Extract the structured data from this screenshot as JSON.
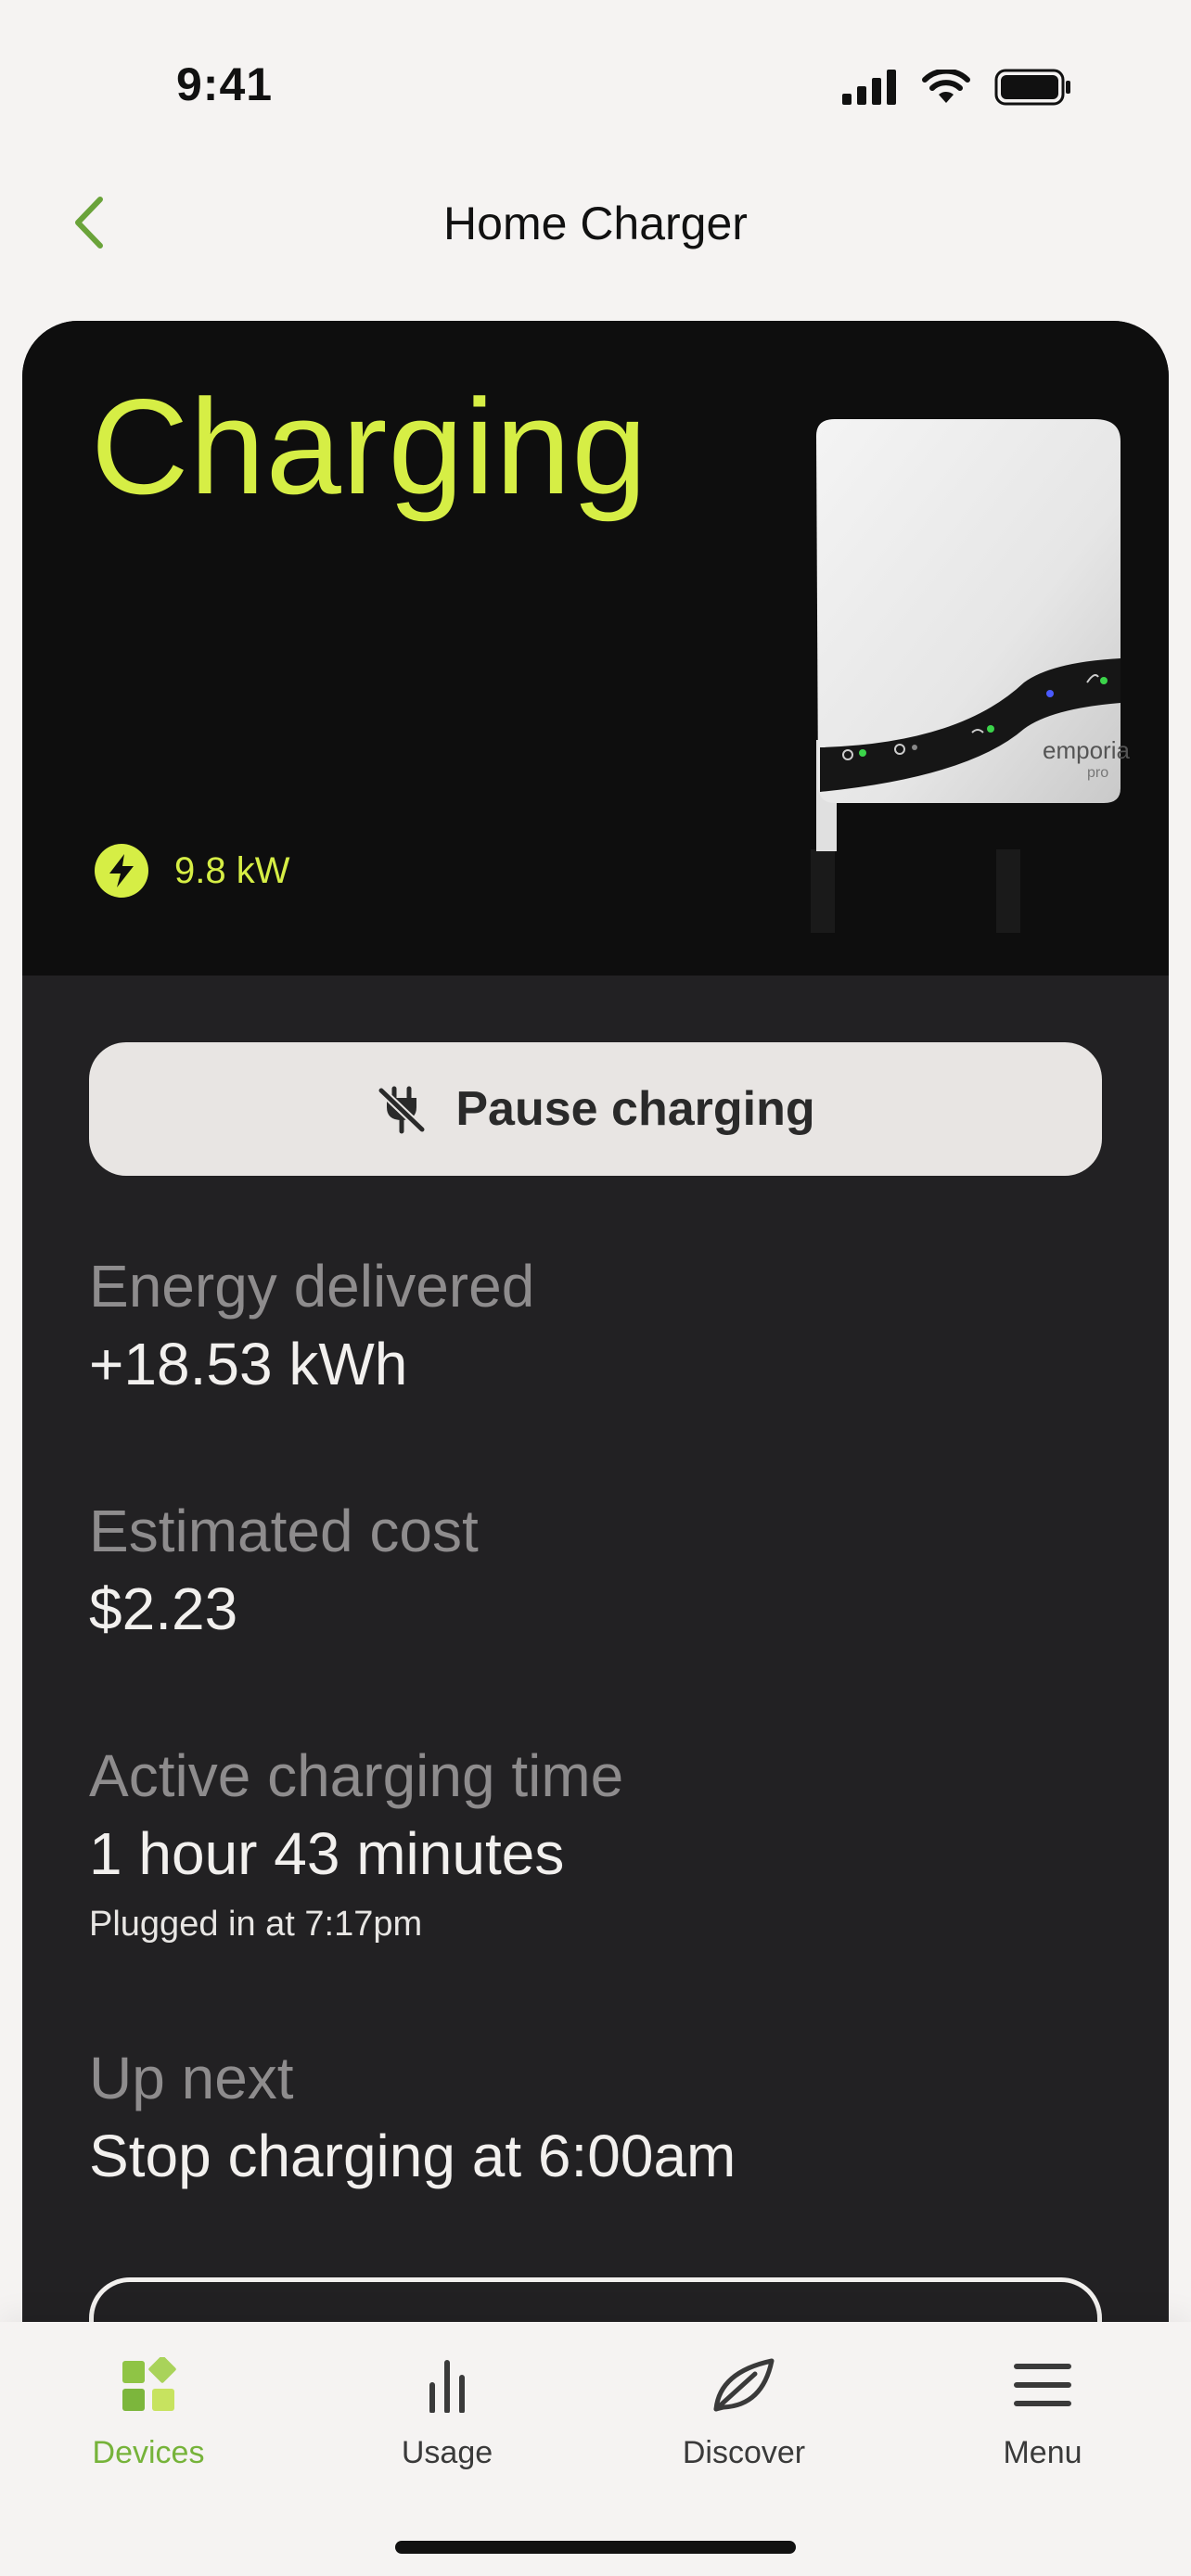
{
  "status_bar": {
    "time": "9:41"
  },
  "nav": {
    "title": "Home Charger"
  },
  "hero": {
    "status": "Charging",
    "power": "9.8 kW",
    "charger_brand": "emporia",
    "charger_model": "pro"
  },
  "actions": {
    "pause_label": "Pause charging"
  },
  "stats": [
    {
      "label": "Energy delivered",
      "value": "+18.53 kWh"
    },
    {
      "label": "Estimated cost",
      "value": "$2.23"
    },
    {
      "label": "Active charging time",
      "value": "1 hour 43 minutes",
      "sub": "Plugged in at 7:17pm"
    },
    {
      "label": "Up next",
      "value": "Stop charging at 6:00am"
    }
  ],
  "tabs": [
    {
      "label": "Devices",
      "icon": "devices-icon",
      "active": true
    },
    {
      "label": "Usage",
      "icon": "usage-icon",
      "active": false
    },
    {
      "label": "Discover",
      "icon": "leaf-icon",
      "active": false
    },
    {
      "label": "Menu",
      "icon": "menu-icon",
      "active": false
    }
  ],
  "colors": {
    "accent": "#d6ee45",
    "active_tab": "#76b33a",
    "card_bg": "#222123",
    "hero_bg": "#0e0e0e"
  }
}
